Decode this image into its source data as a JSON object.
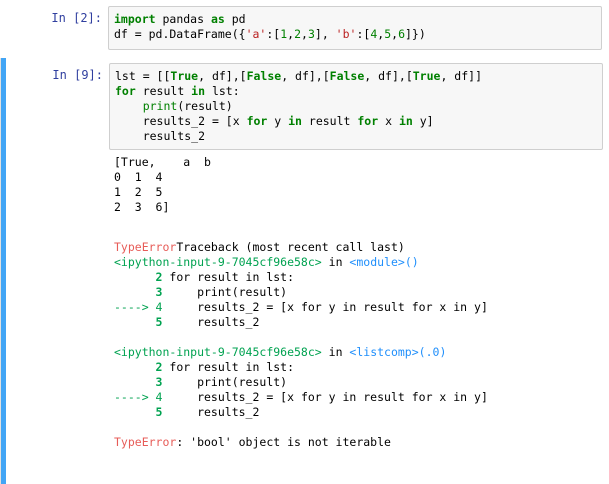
{
  "cell1": {
    "prompt": "In [2]:",
    "line1": {
      "import": "import",
      "mod": " pandas ",
      "as": "as",
      "alias": " pd"
    },
    "line2": {
      "a": "df = pd.DataFrame({",
      "s1": "'a'",
      "b": ":[",
      "n1": "1",
      "c1": ",",
      "n2": "2",
      "c2": ",",
      "n3": "3",
      "c3": "], ",
      "s2": "'b'",
      "d": ":[",
      "n4": "4",
      "c4": ",",
      "n5": "5",
      "c5": ",",
      "n6": "6",
      "e": "]})"
    }
  },
  "cell2": {
    "prompt": "In [9]:",
    "code": {
      "l1": {
        "a": "lst = [[",
        "t1": "True",
        "b": ", df],[",
        "f1": "False",
        "c": ", df],[",
        "f2": "False",
        "d": ", df],[",
        "t2": "True",
        "e": ", df]]"
      },
      "l2": {
        "for": "for",
        "a": " result ",
        "in": "in",
        "b": " lst:"
      },
      "l3": {
        "indent": "    ",
        "print": "print",
        "b": "(result)"
      },
      "l4": {
        "indent": "    ",
        "a": "results_2 = [x ",
        "for": "for",
        "b": " y ",
        "in": "in",
        "c": " result ",
        "for2": "for",
        "d": " x ",
        "in2": "in",
        "e": " y]"
      },
      "l5": {
        "text": "    results_2"
      }
    },
    "output": [
      "[True,    a  b",
      "0  1  4",
      "1  2  5",
      "2  3  6]"
    ],
    "traceback": {
      "header_red": "TypeError",
      "header_rest": "Traceback (most recent call last)",
      "frame1": {
        "file": "<ipython-input-9-7045cf96e58c>",
        "in": " in ",
        "func": "<module>",
        "tail": "()"
      },
      "frame1_lines": [
        {
          "num": "      2",
          "code": " for result in lst:"
        },
        {
          "num": "      3",
          "code": "     print(result)"
        },
        {
          "num": "----> 4",
          "code": "     results_2 = [x for y in result for x in y]"
        },
        {
          "num": "      5",
          "code": "     results_2"
        }
      ],
      "frame2": {
        "file": "<ipython-input-9-7045cf96e58c>",
        "in": " in ",
        "func": "<listcomp>",
        "tail": "(.0)"
      },
      "frame2_lines": [
        {
          "num": "      2",
          "code": " for result in lst:"
        },
        {
          "num": "      3",
          "code": "     print(result)"
        },
        {
          "num": "----> 4",
          "code": "     results_2 = [x for y in result for x in y]"
        },
        {
          "num": "      5",
          "code": "     results_2"
        }
      ],
      "error_red": "TypeError",
      "error_msg": ": 'bool' object is not iterable"
    }
  },
  "colors": {
    "selected_bar": "#42a5f5",
    "prompt": "#303f9f",
    "keyword": "#008000",
    "error_red": "#e75c58",
    "tb_green": "#00a250",
    "tb_blue": "#208ffb"
  }
}
